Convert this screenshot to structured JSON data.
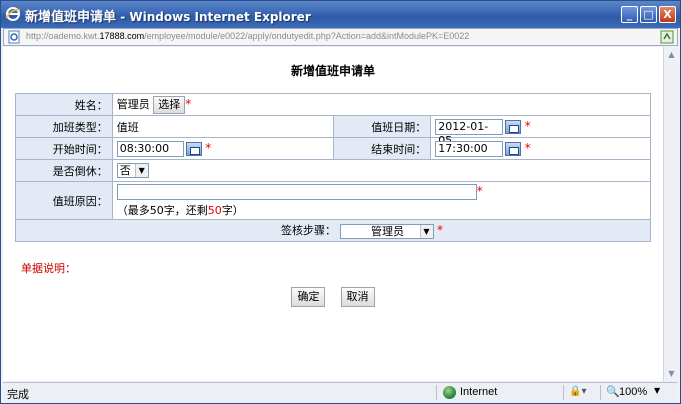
{
  "window": {
    "title_main": "新增值班申请单",
    "title_sub": " - Windows Internet Explorer",
    "controls": {
      "minimize": "_",
      "maximize": "□",
      "close": "X"
    }
  },
  "address": {
    "url_prefix": "http://oademo.kwt.",
    "url_host": "17888.com",
    "url_path": "/employee/module/e0022/apply/ondutyedit.php?Action=add&intModulePK=E0022"
  },
  "form": {
    "title": "新增值班申请单",
    "name_label": "姓名：",
    "name_value": "管理员",
    "select_button": "选择",
    "type_label": "加班类型：",
    "type_value": "值班",
    "date_label": "值班日期：",
    "date_value": "2012-01-05",
    "start_label": "开始时间：",
    "start_value": "08:30:00",
    "end_label": "结束时间：",
    "end_value": "17:30:00",
    "rest_label": "是否倒休：",
    "rest_value": "否",
    "reason_label": "值班原因：",
    "reason_value": "",
    "reason_hint_a": "（最多",
    "reason_hint_max": "50",
    "reason_hint_b": "字，还剩",
    "reason_hint_left": "50",
    "reason_hint_c": "字）",
    "step_label": "签核步骤：",
    "step_value": "管理员",
    "required_mark": "*"
  },
  "remark_label": "单据说明：",
  "buttons": {
    "confirm": "确定",
    "cancel": "取消"
  },
  "status": {
    "done": "完成",
    "zone": "Internet",
    "zoom": "100%"
  },
  "colors": {
    "titlebar": "#3c6ab6",
    "label_bg": "#e3eaf5",
    "required": "#e00000",
    "remark": "#cc0000"
  }
}
